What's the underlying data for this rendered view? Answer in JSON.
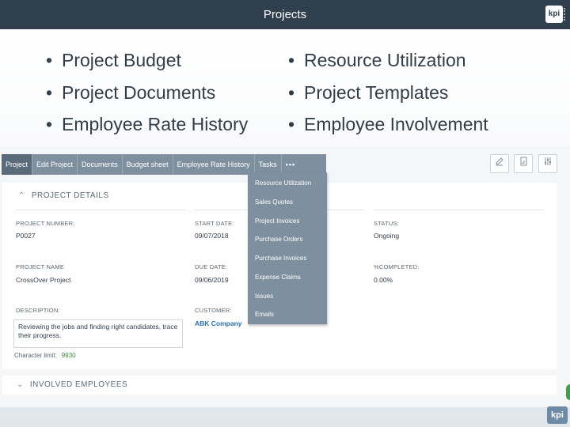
{
  "slide": {
    "title": "Projects",
    "logo": "kpi",
    "bullets_left": [
      "Project Budget",
      "Project Documents",
      "Employee Rate History"
    ],
    "bullets_right": [
      "Resource Utilization",
      "Project Templates",
      "Employee Involvement"
    ],
    "bullet_char": "•"
  },
  "app": {
    "tabs": [
      "Project",
      "Edit Project",
      "Documents",
      "Budget sheet",
      "Employee Rate History",
      "Tasks",
      "•••"
    ],
    "active_tab": "Project",
    "toolbar_icons": [
      "edit-icon",
      "document-icon",
      "settings-sliders-icon"
    ],
    "section_title": "PROJECT DETAILS",
    "fields": {
      "project_number_label": "PROJECT NUMBER:",
      "project_number": "P0027",
      "start_date_label": "START DATE:",
      "start_date": "09/07/2018",
      "status_label": "STATUS:",
      "status": "Ongoing",
      "project_name_label": "PROJECT NAME",
      "project_name": "CrossOver Project",
      "due_date_label": "DUE DATE:",
      "due_date": "09/06/2019",
      "completed_label": "%COMPLETED:",
      "completed": "0.00%",
      "description_label": "DESCRIPTION:",
      "description": "Reviewing the jobs and finding right candidates, trace their progress.",
      "customer_label": "CUSTOMER:",
      "customer": "ABK Company",
      "char_limit_label": "Character limit:",
      "char_limit": "9930"
    },
    "section2_title": "INVOLVED EMPLOYEES",
    "dropdown": [
      "Resource Utilization",
      "Sales Quotes",
      "Project Invoices",
      "Purchase Orders",
      "Purchase Invoices",
      "Expense Claims",
      "Issues",
      "Emails"
    ],
    "chevron_up": "⌃",
    "chevron_down": "⌄"
  }
}
